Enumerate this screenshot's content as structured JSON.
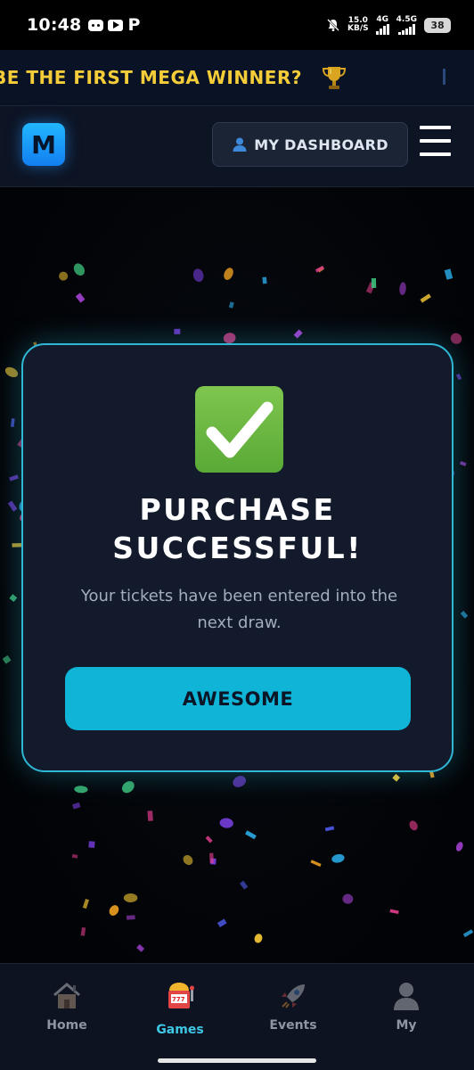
{
  "status_bar": {
    "time": "10:48",
    "net_speed_top": "15.0",
    "net_speed_bottom": "KB/S",
    "net1_label": "4G",
    "net2_label": "4.5G",
    "battery": "38"
  },
  "marquee": {
    "text": "BE THE FIRST MEGA WINNER?",
    "icon": "trophy-icon",
    "color": "#f5cd39"
  },
  "header": {
    "logo_letter": "M",
    "dashboard_label": "MY DASHBOARD",
    "dashboard_icon": "user-icon",
    "menu_icon": "hamburger-icon"
  },
  "modal": {
    "icon": "check-mark-icon",
    "title_line1": "PURCHASE",
    "title_line2": "SUCCESSFUL!",
    "subtitle": "Your tickets have been entered into the next draw.",
    "button_label": "AWESOME",
    "accent": "#0fb4d7"
  },
  "bottom_nav": {
    "items": [
      {
        "label": "Home",
        "icon": "house-icon",
        "active": false
      },
      {
        "label": "Games",
        "icon": "slot-machine-icon",
        "active": true
      },
      {
        "label": "Events",
        "icon": "rocket-icon",
        "active": false
      },
      {
        "label": "My",
        "icon": "person-icon",
        "active": false
      }
    ]
  }
}
